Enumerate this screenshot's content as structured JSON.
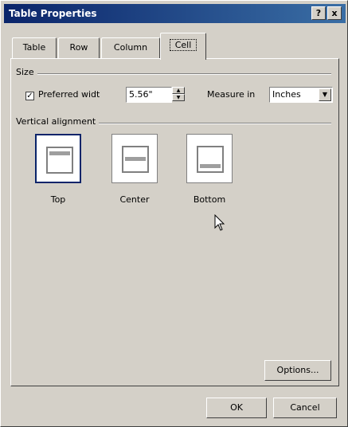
{
  "window": {
    "title": "Table Properties",
    "help_label": "?",
    "close_label": "x"
  },
  "tabs": [
    {
      "label": "Table",
      "active": false
    },
    {
      "label": "Row",
      "active": false
    },
    {
      "label": "Column",
      "active": false
    },
    {
      "label": "Cell",
      "active": true
    }
  ],
  "size": {
    "group_label": "Size",
    "preferred_width_label": "Preferred widt",
    "preferred_width_checked": true,
    "width_value": "5.56\"",
    "measure_label": "Measure in",
    "measure_value": "Inches"
  },
  "vertical_alignment": {
    "group_label": "Vertical alignment",
    "options": [
      {
        "label": "Top",
        "selected": true
      },
      {
        "label": "Center",
        "selected": false
      },
      {
        "label": "Bottom",
        "selected": false
      }
    ]
  },
  "buttons": {
    "options": "Options...",
    "ok": "OK",
    "cancel": "Cancel"
  },
  "colors": {
    "dialog_bg": "#d4d0c8",
    "titlebar": "#0a246a",
    "selected_border": "#0a246a"
  }
}
